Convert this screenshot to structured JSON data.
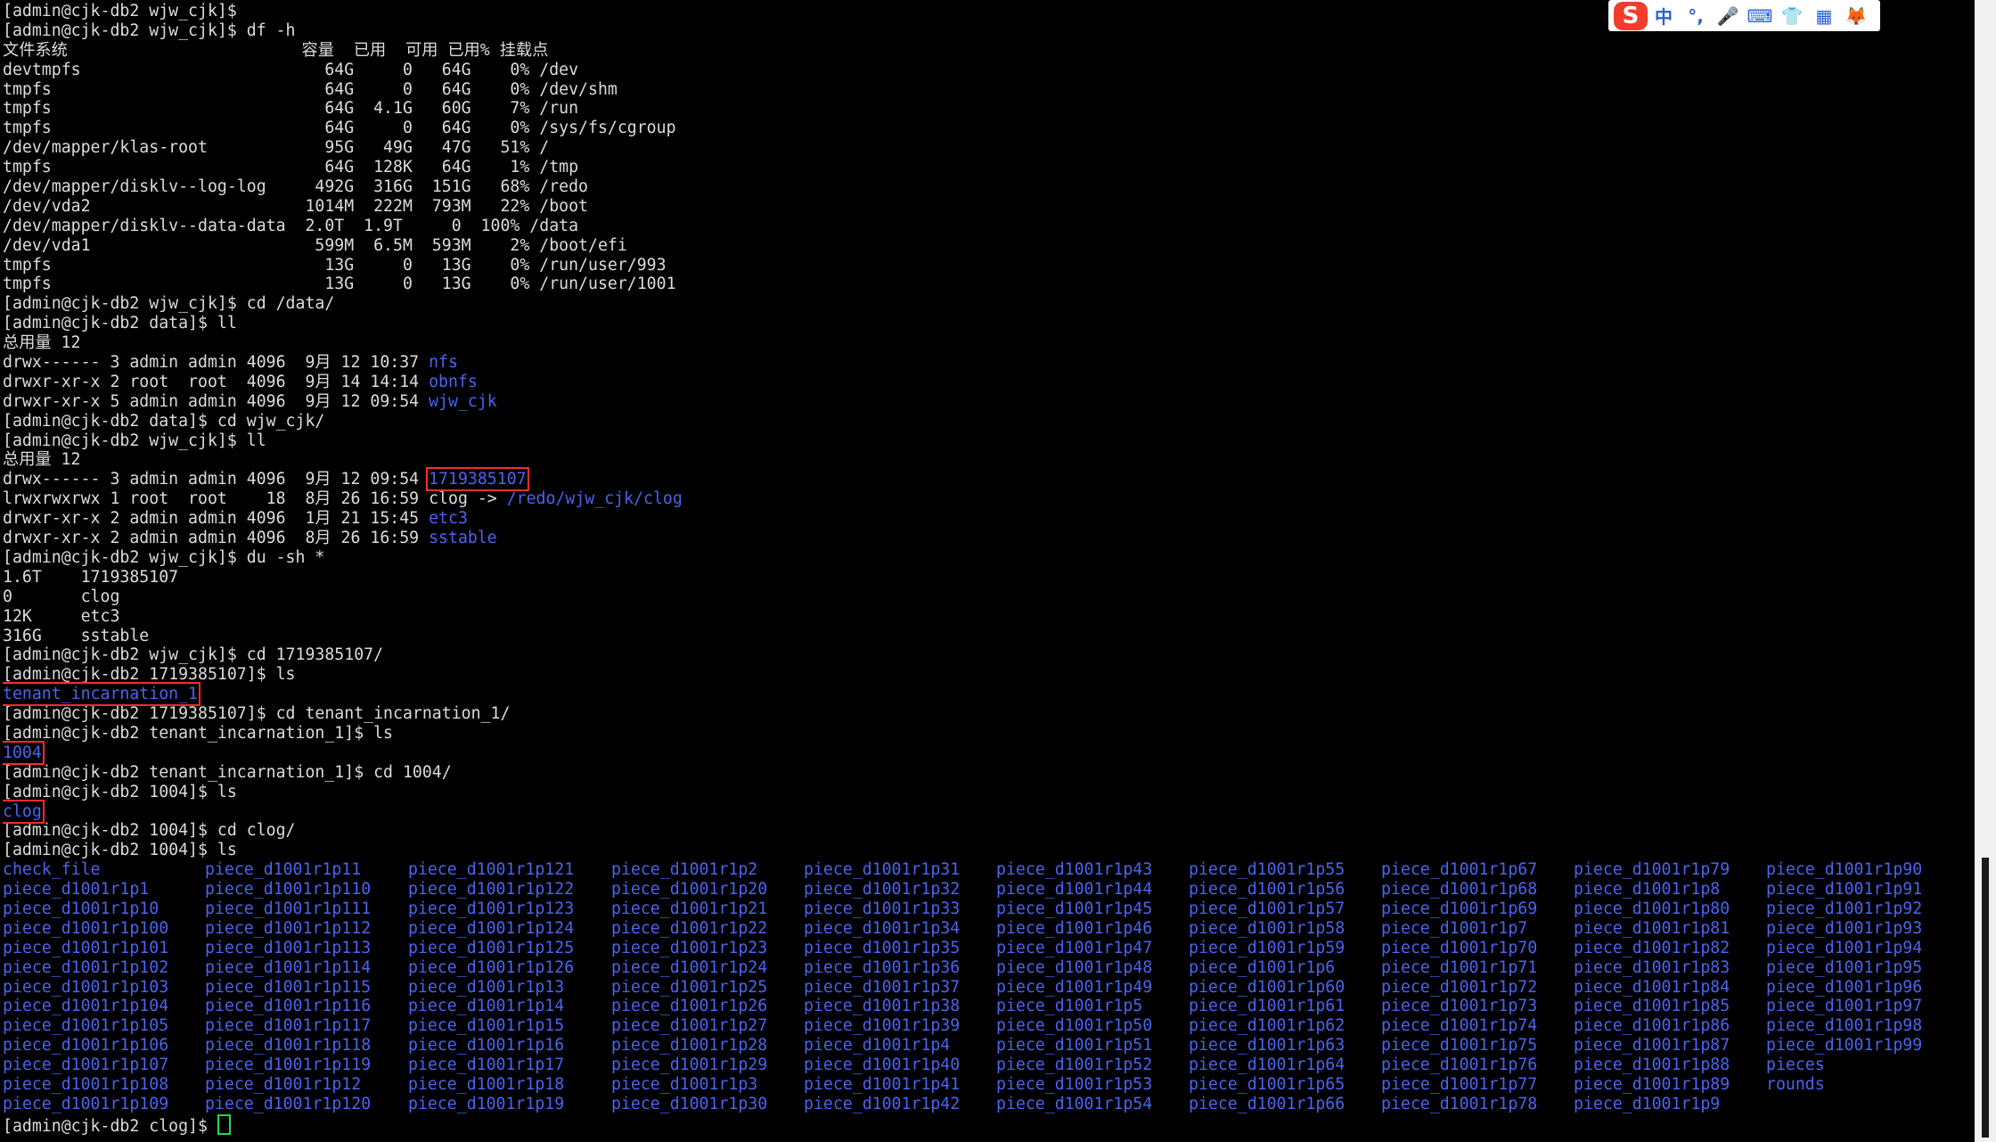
{
  "terminal": {
    "lines": [
      {
        "t": "[admin@cjk-db2 wjw_cjk]$"
      },
      {
        "t": "[admin@cjk-db2 wjw_cjk]$ df -h"
      },
      {
        "t": "文件系统                        容量  已用  可用 已用% 挂载点"
      },
      {
        "t": "devtmpfs                         64G     0   64G    0% /dev"
      },
      {
        "t": "tmpfs                            64G     0   64G    0% /dev/shm"
      },
      {
        "t": "tmpfs                            64G  4.1G   60G    7% /run"
      },
      {
        "t": "tmpfs                            64G     0   64G    0% /sys/fs/cgroup"
      },
      {
        "t": "/dev/mapper/klas-root            95G   49G   47G   51% /"
      },
      {
        "t": "tmpfs                            64G  128K   64G    1% /tmp"
      },
      {
        "t": "/dev/mapper/disklv--log-log     492G  316G  151G   68% /redo"
      },
      {
        "t": "/dev/vda2                      1014M  222M  793M   22% /boot"
      },
      {
        "t": "/dev/mapper/disklv--data-data  2.0T  1.9T     0  100% /data"
      },
      {
        "t": "/dev/vda1                       599M  6.5M  593M    2% /boot/efi"
      },
      {
        "t": "tmpfs                            13G     0   13G    0% /run/user/993"
      },
      {
        "t": "tmpfs                            13G     0   13G    0% /run/user/1001"
      },
      {
        "t": "[admin@cjk-db2 wjw_cjk]$ cd /data/"
      },
      {
        "t": "[admin@cjk-db2 data]$ ll"
      },
      {
        "t": "总用量 12"
      },
      {
        "t": "drwx------ 3 admin admin 4096  9月 12 10:37 ",
        "b": "nfs"
      },
      {
        "t": "drwxr-xr-x 2 root  root  4096  9月 14 14:14 ",
        "b": "obnfs"
      },
      {
        "t": "drwxr-xr-x 5 admin admin 4096  9月 12 09:54 ",
        "b": "wjw_cjk"
      },
      {
        "t": "[admin@cjk-db2 data]$ cd wjw_cjk/"
      },
      {
        "t": "[admin@cjk-db2 wjw_cjk]$ ll"
      },
      {
        "t": "总用量 12"
      },
      {
        "t": "drwx------ 3 admin admin 4096  9月 12 09:54 ",
        "b": "1719385107",
        "hl": true
      },
      {
        "t": "lrwxrwxrwx 1 root  root    18  8月 26 16:59 ",
        "c": "clog -> ",
        "b": "/redo/wjw_cjk/clog"
      },
      {
        "t": "drwxr-xr-x 2 admin admin 4096  1月 21 15:45 ",
        "b": "etc3"
      },
      {
        "t": "drwxr-xr-x 2 admin admin 4096  8月 26 16:59 ",
        "b": "sstable"
      },
      {
        "t": "[admin@cjk-db2 wjw_cjk]$ du -sh *"
      },
      {
        "t": "1.6T    1719385107"
      },
      {
        "t": "0       clog"
      },
      {
        "t": "12K     etc3"
      },
      {
        "t": "316G    sstable"
      },
      {
        "t": "[admin@cjk-db2 wjw_cjk]$ cd 1719385107/"
      },
      {
        "t": "[admin@cjk-db2 1719385107]$ ls"
      },
      {
        "t": "",
        "b": "tenant_incarnation_1",
        "hl": true
      },
      {
        "t": "[admin@cjk-db2 1719385107]$ cd tenant_incarnation_1/"
      },
      {
        "t": "[admin@cjk-db2 tenant_incarnation_1]$ ls"
      },
      {
        "t": "",
        "b": "1004",
        "hl": true
      },
      {
        "t": "[admin@cjk-db2 tenant_incarnation_1]$ cd 1004/"
      },
      {
        "t": "[admin@cjk-db2 1004]$ ls"
      },
      {
        "t": "",
        "b": "clog",
        "hl": true
      },
      {
        "t": "[admin@cjk-db2 1004]$ cd clog/"
      },
      {
        "t": "[admin@cjk-db2 1004]$ ls"
      }
    ],
    "file_grid": [
      [
        "check_file",
        "piece_d1001r1p11",
        "piece_d1001r1p121",
        "piece_d1001r1p2",
        "piece_d1001r1p31",
        "piece_d1001r1p43",
        "piece_d1001r1p55",
        "piece_d1001r1p67",
        "piece_d1001r1p79",
        "piece_d1001r1p90"
      ],
      [
        "piece_d1001r1p1",
        "piece_d1001r1p110",
        "piece_d1001r1p122",
        "piece_d1001r1p20",
        "piece_d1001r1p32",
        "piece_d1001r1p44",
        "piece_d1001r1p56",
        "piece_d1001r1p68",
        "piece_d1001r1p8",
        "piece_d1001r1p91"
      ],
      [
        "piece_d1001r1p10",
        "piece_d1001r1p111",
        "piece_d1001r1p123",
        "piece_d1001r1p21",
        "piece_d1001r1p33",
        "piece_d1001r1p45",
        "piece_d1001r1p57",
        "piece_d1001r1p69",
        "piece_d1001r1p80",
        "piece_d1001r1p92"
      ],
      [
        "piece_d1001r1p100",
        "piece_d1001r1p112",
        "piece_d1001r1p124",
        "piece_d1001r1p22",
        "piece_d1001r1p34",
        "piece_d1001r1p46",
        "piece_d1001r1p58",
        "piece_d1001r1p7",
        "piece_d1001r1p81",
        "piece_d1001r1p93"
      ],
      [
        "piece_d1001r1p101",
        "piece_d1001r1p113",
        "piece_d1001r1p125",
        "piece_d1001r1p23",
        "piece_d1001r1p35",
        "piece_d1001r1p47",
        "piece_d1001r1p59",
        "piece_d1001r1p70",
        "piece_d1001r1p82",
        "piece_d1001r1p94"
      ],
      [
        "piece_d1001r1p102",
        "piece_d1001r1p114",
        "piece_d1001r1p126",
        "piece_d1001r1p24",
        "piece_d1001r1p36",
        "piece_d1001r1p48",
        "piece_d1001r1p6",
        "piece_d1001r1p71",
        "piece_d1001r1p83",
        "piece_d1001r1p95"
      ],
      [
        "piece_d1001r1p103",
        "piece_d1001r1p115",
        "piece_d1001r1p13",
        "piece_d1001r1p25",
        "piece_d1001r1p37",
        "piece_d1001r1p49",
        "piece_d1001r1p60",
        "piece_d1001r1p72",
        "piece_d1001r1p84",
        "piece_d1001r1p96"
      ],
      [
        "piece_d1001r1p104",
        "piece_d1001r1p116",
        "piece_d1001r1p14",
        "piece_d1001r1p26",
        "piece_d1001r1p38",
        "piece_d1001r1p5",
        "piece_d1001r1p61",
        "piece_d1001r1p73",
        "piece_d1001r1p85",
        "piece_d1001r1p97"
      ],
      [
        "piece_d1001r1p105",
        "piece_d1001r1p117",
        "piece_d1001r1p15",
        "piece_d1001r1p27",
        "piece_d1001r1p39",
        "piece_d1001r1p50",
        "piece_d1001r1p62",
        "piece_d1001r1p74",
        "piece_d1001r1p86",
        "piece_d1001r1p98"
      ],
      [
        "piece_d1001r1p106",
        "piece_d1001r1p118",
        "piece_d1001r1p16",
        "piece_d1001r1p28",
        "piece_d1001r1p4",
        "piece_d1001r1p51",
        "piece_d1001r1p63",
        "piece_d1001r1p75",
        "piece_d1001r1p87",
        "piece_d1001r1p99"
      ],
      [
        "piece_d1001r1p107",
        "piece_d1001r1p119",
        "piece_d1001r1p17",
        "piece_d1001r1p29",
        "piece_d1001r1p40",
        "piece_d1001r1p52",
        "piece_d1001r1p64",
        "piece_d1001r1p76",
        "piece_d1001r1p88",
        "pieces"
      ],
      [
        "piece_d1001r1p108",
        "piece_d1001r1p12",
        "piece_d1001r1p18",
        "piece_d1001r1p3",
        "piece_d1001r1p41",
        "piece_d1001r1p53",
        "piece_d1001r1p65",
        "piece_d1001r1p77",
        "piece_d1001r1p89",
        "rounds"
      ],
      [
        "piece_d1001r1p109",
        "piece_d1001r1p120",
        "piece_d1001r1p19",
        "piece_d1001r1p30",
        "piece_d1001r1p42",
        "piece_d1001r1p54",
        "piece_d1001r1p66",
        "piece_d1001r1p78",
        "piece_d1001r1p9",
        ""
      ]
    ],
    "final_prompt": "[admin@cjk-db2 clog]$ "
  },
  "ime_toolbar": {
    "logo": "S",
    "items": [
      {
        "icon": "chinese-mode-icon",
        "glyph": "中"
      },
      {
        "icon": "punctuation-icon",
        "glyph": "°,"
      },
      {
        "icon": "microphone-icon",
        "glyph": "🎤"
      },
      {
        "icon": "keyboard-icon",
        "glyph": "⌨"
      },
      {
        "icon": "skin-icon",
        "glyph": "👕"
      },
      {
        "icon": "apps-grid-icon",
        "glyph": "▦"
      },
      {
        "icon": "mascot-icon",
        "glyph": "🦊"
      }
    ]
  },
  "colors": {
    "background": "#000000",
    "text": "#dcdcdc",
    "dir": "#4a64f0",
    "highlight": "#ff2a2a",
    "cursor": "#27d35b"
  }
}
